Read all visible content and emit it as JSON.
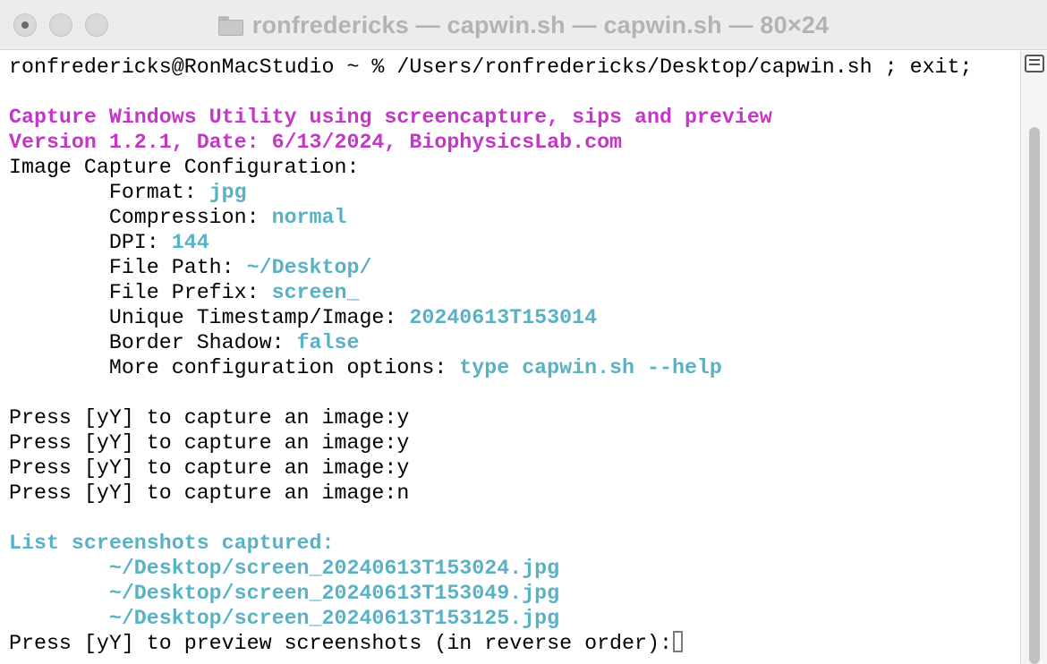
{
  "window": {
    "title": "ronfredericks — capwin.sh — capwin.sh — 80×24"
  },
  "terminal": {
    "prompt_line": "ronfredericks@RonMacStudio ~ % /Users/ronfredericks/Desktop/capwin.sh ; exit;",
    "header": {
      "line1": "Capture Windows Utility using screencapture, sips and preview",
      "line2": "Version 1.2.1, Date: 6/13/2024, BiophysicsLab.com"
    },
    "config_heading": "Image Capture Configuration:",
    "config": [
      {
        "label": "        Format: ",
        "value": "jpg"
      },
      {
        "label": "        Compression: ",
        "value": "normal"
      },
      {
        "label": "        DPI: ",
        "value": "144"
      },
      {
        "label": "        File Path: ",
        "value": "~/Desktop/"
      },
      {
        "label": "        File Prefix: ",
        "value": "screen_"
      },
      {
        "label": "        Unique Timestamp/Image: ",
        "value": "20240613T153014"
      },
      {
        "label": "        Border Shadow: ",
        "value": "false"
      },
      {
        "label": "        More configuration options: ",
        "value": "type capwin.sh --help"
      }
    ],
    "capture_prompts": [
      "Press [yY] to capture an image:y",
      "Press [yY] to capture an image:y",
      "Press [yY] to capture an image:y",
      "Press [yY] to capture an image:n"
    ],
    "list_heading": "List screenshots captured:",
    "screenshots": [
      "        ~/Desktop/screen_20240613T153024.jpg",
      "        ~/Desktop/screen_20240613T153049.jpg",
      "        ~/Desktop/screen_20240613T153125.jpg"
    ],
    "preview_prompt": "Press [yY] to preview screenshots (in reverse order):"
  },
  "colors": {
    "magenta": "#c535c8",
    "cyan": "#58b2c6",
    "text": "#000000"
  },
  "icons": {
    "close": "close-icon",
    "folder": "folder-icon",
    "scrollbar": "scroll-marks-icon"
  }
}
